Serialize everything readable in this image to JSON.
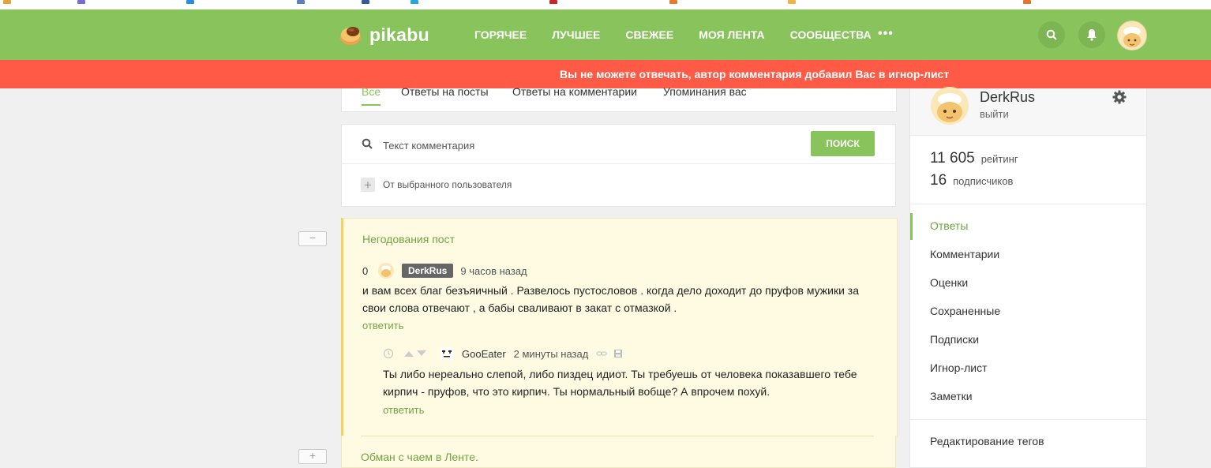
{
  "header": {
    "logo_text": "pikabu",
    "nav": [
      "ГОРЯЧЕЕ",
      "ЛУЧШЕЕ",
      "СВЕЖЕЕ",
      "МОЯ ЛЕНТА",
      "СООБЩЕСТВА"
    ],
    "more": "•••"
  },
  "alert": {
    "text": "Вы не можете отвечать, автор комментария добавил Вас в игнор-лист"
  },
  "tabs": [
    "Все",
    "Ответы на посты",
    "Ответы на комментарии",
    "Упоминания вас"
  ],
  "search": {
    "placeholder": "Текст комментария",
    "button": "ПОИСК",
    "user_filter": "От выбранного пользователя"
  },
  "collapse": {
    "minus": "−",
    "plus": "+"
  },
  "comment": {
    "post_title": "Негодования пост",
    "rating": "0",
    "username": "DerkRus",
    "time": "9 часов назад",
    "text": "и вам всех благ безъяичный . Развелось пустословов . когда дело доходит до пруфов мужики за свои слова отвечают , а бабы сваливают в закат с отмазкой .",
    "reply_label": "ответить"
  },
  "reply": {
    "username": "GooEater",
    "time": "2 минуты назад",
    "text": "Ты либо нереально слепой, либо пиздец идиот. Ты требуешь от человека показавшего тебе кирпич - пруфов, что это кирпич. Ты нормальный вобще? А впрочем похуй.",
    "reply_label": "ответить"
  },
  "next_post": {
    "title": "Обман с чаем в Ленте."
  },
  "sidebar": {
    "username": "DerkRus",
    "logout": "выйти",
    "rating_value": "11 605",
    "rating_label": "рейтинг",
    "subscribers_value": "16",
    "subscribers_label": "подписчиков",
    "menu": [
      "Ответы",
      "Комментарии",
      "Оценки",
      "Сохраненные",
      "Подписки",
      "Игнор-лист",
      "Заметки"
    ],
    "tags_edit": "Редактирование тегов"
  },
  "colors": {
    "brand_green": "#88c45b",
    "alert_red": "#ff5a46",
    "link_green": "#6fa542",
    "comment_bg": "#fffbe3",
    "comment_border": "#f4d25f"
  }
}
